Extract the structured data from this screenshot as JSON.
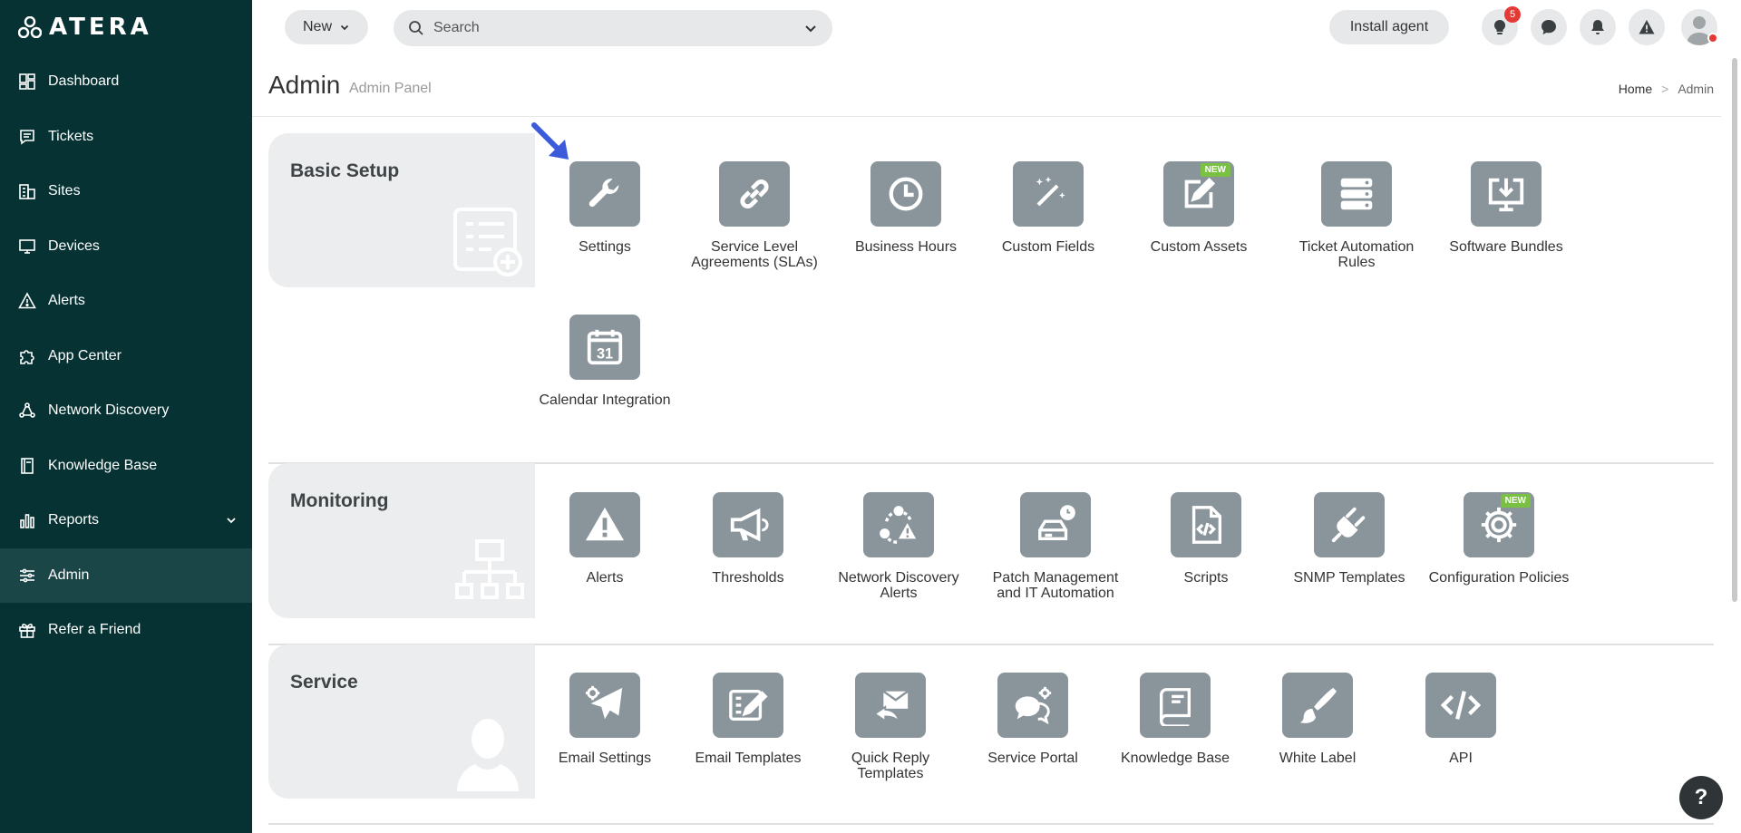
{
  "brand": {
    "logo_text": "ATERA"
  },
  "sidebar": {
    "items": [
      {
        "label": "Dashboard",
        "icon": "dashboard-icon"
      },
      {
        "label": "Tickets",
        "icon": "tickets-icon"
      },
      {
        "label": "Sites",
        "icon": "sites-icon"
      },
      {
        "label": "Devices",
        "icon": "devices-icon"
      },
      {
        "label": "Alerts",
        "icon": "alerts-icon"
      },
      {
        "label": "App Center",
        "icon": "puzzle-icon"
      },
      {
        "label": "Network Discovery",
        "icon": "network-icon"
      },
      {
        "label": "Knowledge Base",
        "icon": "book-icon"
      },
      {
        "label": "Reports",
        "icon": "bar-chart-icon"
      },
      {
        "label": "Admin",
        "icon": "sliders-icon",
        "active": true
      },
      {
        "label": "Refer a Friend",
        "icon": "gift-icon"
      }
    ]
  },
  "header": {
    "new_label": "New",
    "search_placeholder": "Search",
    "install_label": "Install agent",
    "notifications_count": "5"
  },
  "page": {
    "title": "Admin",
    "subtitle": "Admin Panel",
    "breadcrumb": {
      "home": "Home",
      "sep": ">",
      "current": "Admin"
    }
  },
  "sections": {
    "basic_setup": {
      "title": "Basic Setup",
      "tiles": [
        {
          "label": "Settings",
          "icon": "wrench-icon"
        },
        {
          "label": "Service Level Agreements (SLAs)",
          "icon": "link-icon"
        },
        {
          "label": "Business Hours",
          "icon": "clock-icon"
        },
        {
          "label": "Custom Fields",
          "icon": "magic-wand-icon"
        },
        {
          "label": "Custom Assets",
          "icon": "edit-icon",
          "badge": "NEW"
        },
        {
          "label": "Ticket Automation Rules",
          "icon": "server-stack-icon"
        },
        {
          "label": "Software Bundles",
          "icon": "download-monitor-icon"
        },
        {
          "label": "Calendar Integration",
          "icon": "calendar-icon",
          "day": "31"
        }
      ]
    },
    "monitoring": {
      "title": "Monitoring",
      "tiles": [
        {
          "label": "Alerts",
          "icon": "warning-icon"
        },
        {
          "label": "Thresholds",
          "icon": "megaphone-icon"
        },
        {
          "label": "Network Discovery Alerts",
          "icon": "network-alert-icon"
        },
        {
          "label": "Patch Management and IT Automation",
          "icon": "drive-clock-icon"
        },
        {
          "label": "Scripts",
          "icon": "code-file-icon"
        },
        {
          "label": "SNMP Templates",
          "icon": "plug-icon"
        },
        {
          "label": "Configuration Policies",
          "icon": "gear-icon",
          "badge": "NEW"
        }
      ]
    },
    "service": {
      "title": "Service",
      "tiles": [
        {
          "label": "Email Settings",
          "icon": "paper-plane-gear-icon"
        },
        {
          "label": "Email Templates",
          "icon": "template-edit-icon"
        },
        {
          "label": "Quick Reply Templates",
          "icon": "reply-envelope-icon"
        },
        {
          "label": "Service Portal",
          "icon": "chat-gear-icon"
        },
        {
          "label": "Knowledge Base",
          "icon": "book-icon"
        },
        {
          "label": "White Label",
          "icon": "brush-icon"
        },
        {
          "label": "API",
          "icon": "code-icon"
        }
      ]
    }
  },
  "help_label": "?"
}
